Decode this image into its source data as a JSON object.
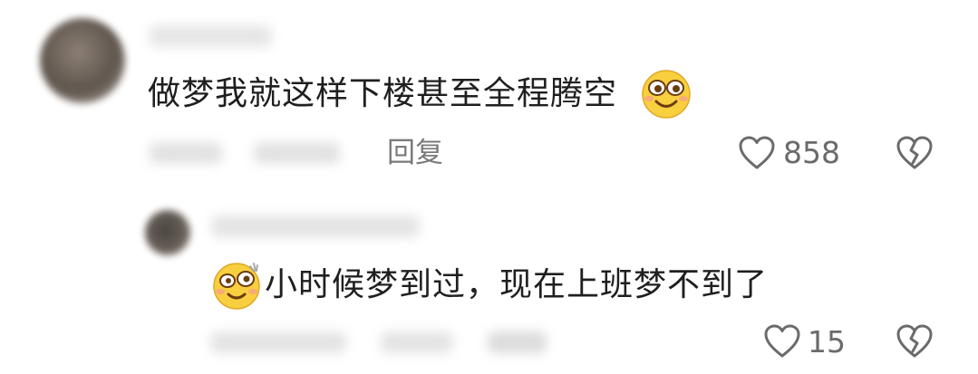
{
  "comment_main": {
    "text": "做梦我就这样下楼甚至全程腾空",
    "emoji": "smiling-face-emoji",
    "reply_label": "回复",
    "like_count": "858"
  },
  "comment_reply": {
    "text": "小时候梦到过，现在上班梦不到了",
    "emoji": "dazed-face-emoji",
    "like_count": "15"
  },
  "colors": {
    "text": "#1f1f1f",
    "meta": "#7a7a7a",
    "icon": "#6b6b6b",
    "emoji_yellow": "#f8cf3f"
  }
}
